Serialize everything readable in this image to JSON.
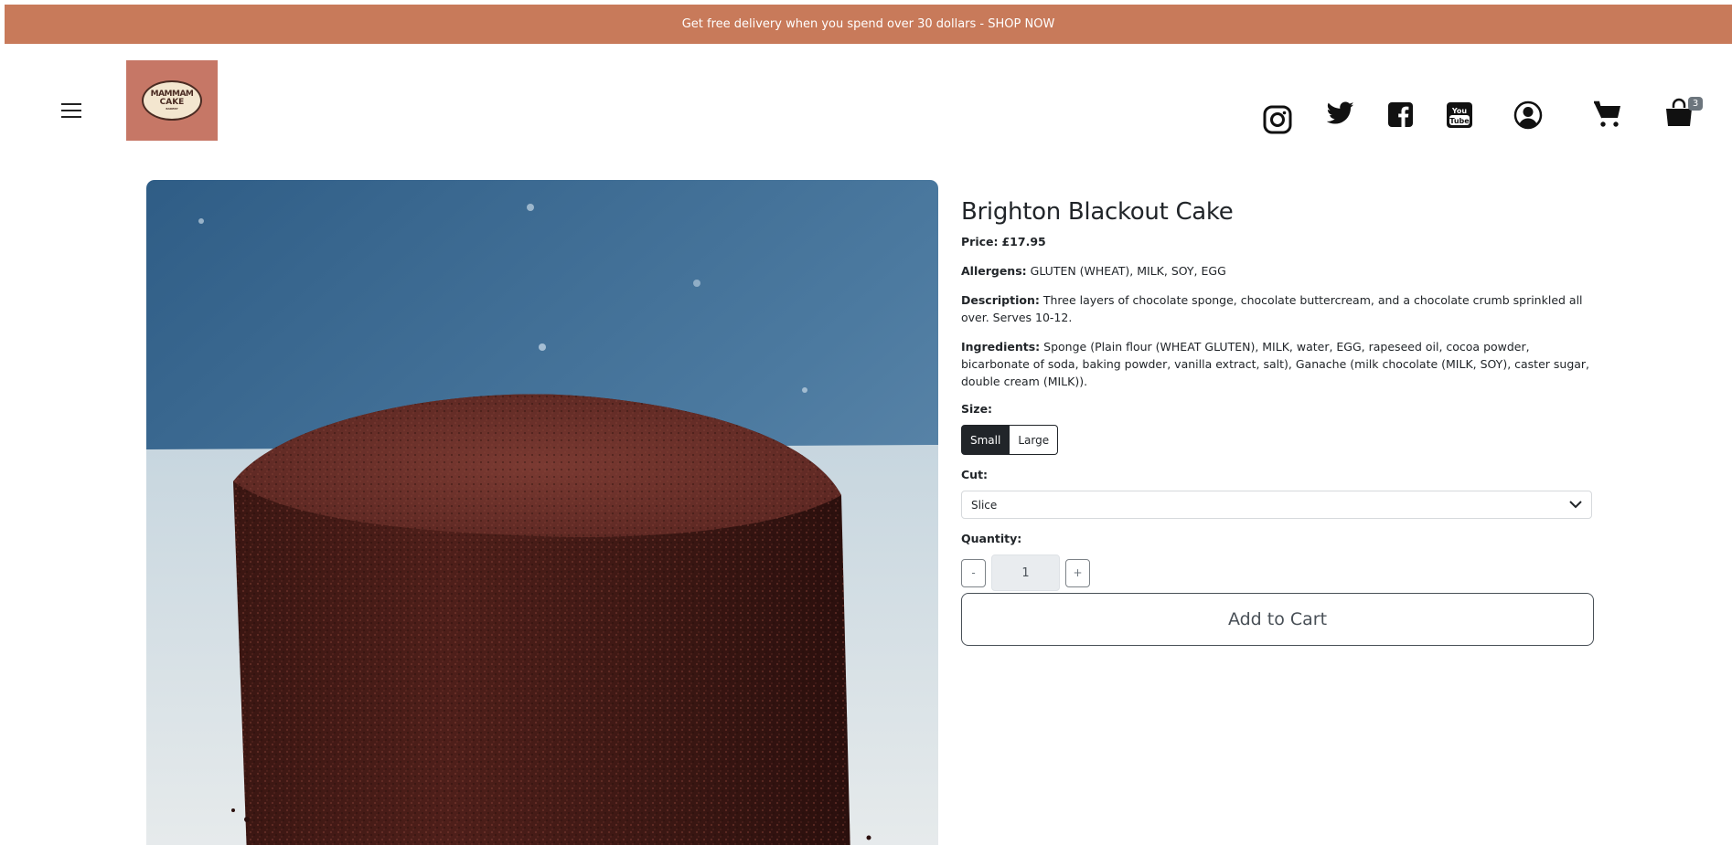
{
  "promo": {
    "text": "Get free delivery when you spend over 30 dollars - SHOP NOW"
  },
  "header": {
    "logo": {
      "line1": "MAMMAM",
      "line2": "CAKE",
      "line3": "BAKERY"
    },
    "cart_count": "3",
    "icons": [
      "menu-icon",
      "instagram-icon",
      "twitter-icon",
      "facebook-icon",
      "youtube-icon",
      "account-icon",
      "cart-icon",
      "shopping-bag-icon"
    ]
  },
  "product": {
    "title": "Brighton Blackout Cake",
    "price_label": "Price:",
    "price": "£17.95",
    "allergens_label": "Allergens:",
    "allergens": "GLUTEN (WHEAT), MILK, SOY, EGG",
    "description_label": "Description:",
    "description": "Three layers of chocolate sponge, chocolate buttercream, and a chocolate crumb sprinkled all over. Serves 10-12.",
    "ingredients_label": "Ingredients:",
    "ingredients": "Sponge (Plain flour (WHEAT GLUTEN), MILK, water, EGG, rapeseed oil, cocoa powder, bicarbonate of soda, baking powder, vanilla extract, salt), Ganache (milk chocolate (MILK, SOY), caster sugar, double cream (MILK)).",
    "size_label": "Size:",
    "sizes": [
      "Small",
      "Large"
    ],
    "selected_size": "Small",
    "cut_label": "Cut:",
    "cut_value": "Slice",
    "quantity_label": "Quantity:",
    "quantity": "1",
    "minus": "-",
    "plus": "+",
    "add_to_cart": "Add to Cart"
  },
  "colors": {
    "promo_bg": "#c87a5a",
    "logo_bg": "#c67766",
    "dark": "#212529"
  }
}
